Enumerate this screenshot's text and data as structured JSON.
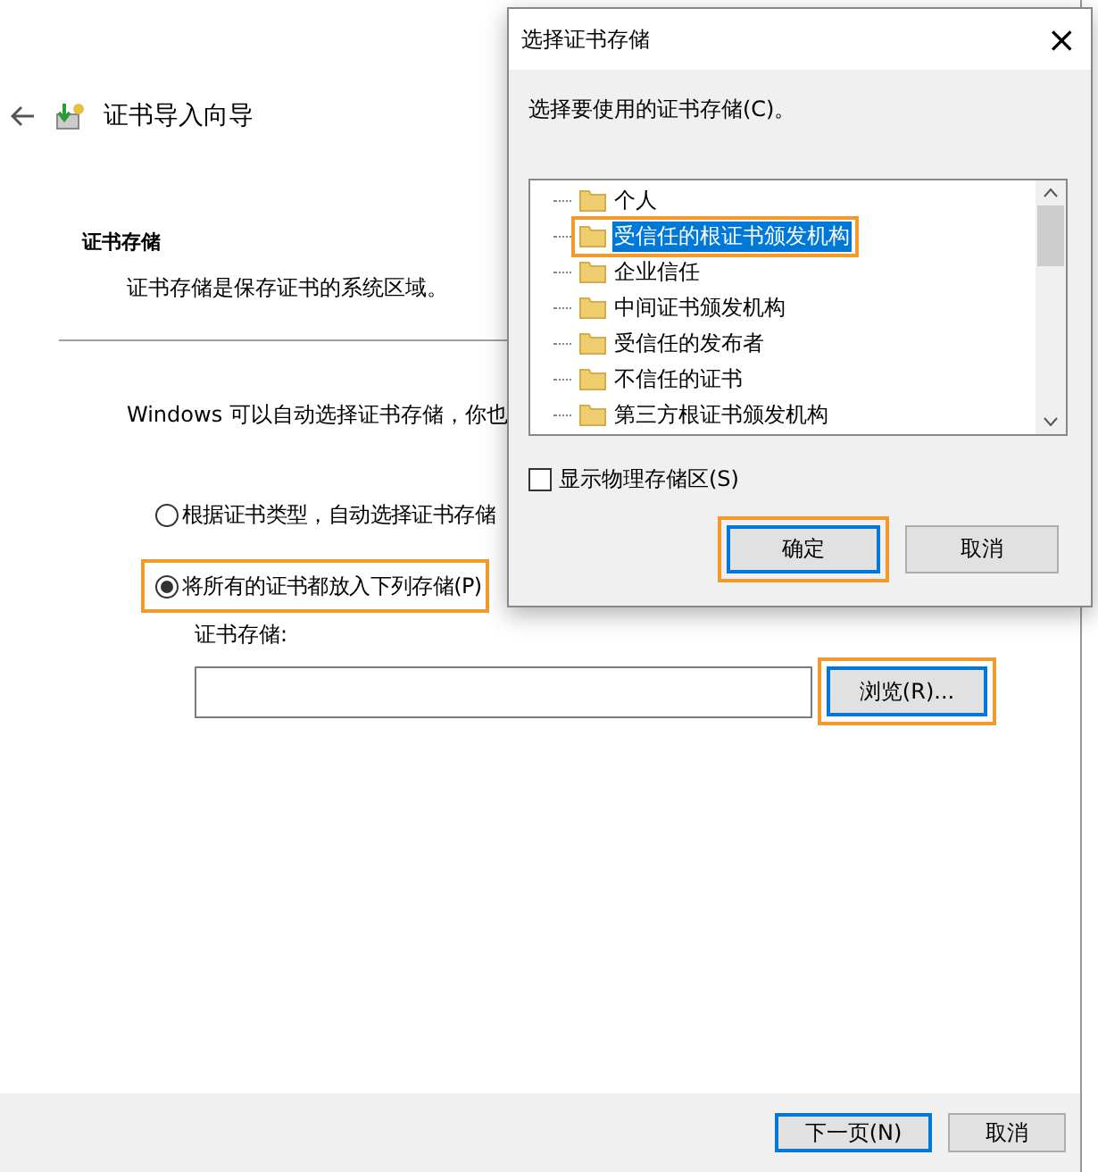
{
  "wizard": {
    "title": "证书导入向导",
    "section_title": "证书存储",
    "section_desc": "证书存储是保存证书的系统区域。",
    "intro": "Windows 可以自动选择证书存储，你也",
    "radios": [
      {
        "label": "根据证书类型，自动选择证书存储",
        "selected": false,
        "highlighted": false
      },
      {
        "label": "将所有的证书都放入下列存储(P)",
        "selected": true,
        "highlighted": true
      }
    ],
    "store_label": "证书存储:",
    "browse": {
      "label": "浏览(R)...",
      "highlighted": true
    },
    "buttons": [
      {
        "label": "下一页(N)",
        "default": true
      },
      {
        "label": "取消",
        "default": false
      }
    ]
  },
  "dialog": {
    "title": "选择证书存储",
    "close": "×",
    "prompt": "选择要使用的证书存储(C)。",
    "stores": [
      {
        "label": "个人",
        "selected": false,
        "highlighted": false
      },
      {
        "label": "受信任的根证书颁发机构",
        "selected": true,
        "highlighted": true
      },
      {
        "label": "企业信任",
        "selected": false,
        "highlighted": false
      },
      {
        "label": "中间证书颁发机构",
        "selected": false,
        "highlighted": false
      },
      {
        "label": "受信任的发布者",
        "selected": false,
        "highlighted": false
      },
      {
        "label": "不信任的证书",
        "selected": false,
        "highlighted": false
      },
      {
        "label": "第三方根证书颁发机构",
        "selected": false,
        "highlighted": false
      }
    ],
    "show_physical": {
      "label": "显示物理存储区(S)",
      "checked": false
    },
    "buttons": [
      {
        "label": "确定",
        "default": true,
        "highlighted": true
      },
      {
        "label": "取消",
        "default": false,
        "highlighted": false
      }
    ]
  }
}
